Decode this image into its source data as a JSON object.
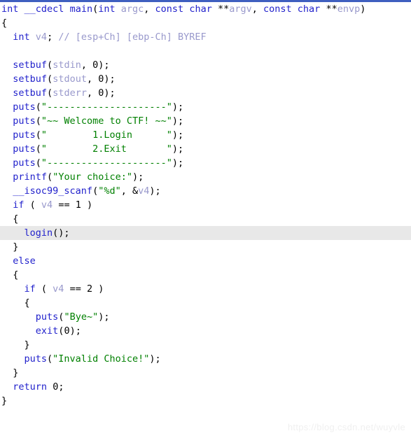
{
  "window": {
    "kind": "decompiler-pseudocode-view",
    "top_rule_color": "#3f5fbf",
    "background_color": "#ffffff",
    "highlight_color": "#e8e8e8"
  },
  "theme": {
    "keyword_color": "#2222cc",
    "function_color": "#2222cc",
    "string_color": "#008000",
    "comment_color": "#9999cc",
    "variable_color": "#9999cc",
    "punctuation_color": "#000000"
  },
  "watermark": {
    "text": "https://blog.csdn.net/wuyvle"
  },
  "code": {
    "highlighted_line_index": 16,
    "lines": [
      {
        "n": 0,
        "tokens": [
          {
            "t": "kw",
            "v": "int"
          },
          {
            "t": "pun",
            "v": " "
          },
          {
            "t": "sym",
            "v": "__cdecl"
          },
          {
            "t": "pun",
            "v": " "
          },
          {
            "t": "sym",
            "v": "main"
          },
          {
            "t": "pun",
            "v": "("
          },
          {
            "t": "kw",
            "v": "int"
          },
          {
            "t": "pun",
            "v": " "
          },
          {
            "t": "var",
            "v": "argc"
          },
          {
            "t": "pun",
            "v": ", "
          },
          {
            "t": "kw",
            "v": "const"
          },
          {
            "t": "pun",
            "v": " "
          },
          {
            "t": "kw",
            "v": "char"
          },
          {
            "t": "pun",
            "v": " **"
          },
          {
            "t": "var",
            "v": "argv"
          },
          {
            "t": "pun",
            "v": ", "
          },
          {
            "t": "kw",
            "v": "const"
          },
          {
            "t": "pun",
            "v": " "
          },
          {
            "t": "kw",
            "v": "char"
          },
          {
            "t": "pun",
            "v": " **"
          },
          {
            "t": "var",
            "v": "envp"
          },
          {
            "t": "pun",
            "v": ")"
          }
        ]
      },
      {
        "n": 1,
        "tokens": [
          {
            "t": "pun",
            "v": "{"
          }
        ]
      },
      {
        "n": 2,
        "tokens": [
          {
            "t": "pun",
            "v": "  "
          },
          {
            "t": "kw",
            "v": "int"
          },
          {
            "t": "pun",
            "v": " "
          },
          {
            "t": "var",
            "v": "v4"
          },
          {
            "t": "pun",
            "v": "; "
          },
          {
            "t": "cmt",
            "v": "// [esp+Ch] [ebp-Ch] BYREF"
          }
        ]
      },
      {
        "n": 3,
        "tokens": [
          {
            "t": "pun",
            "v": ""
          }
        ]
      },
      {
        "n": 4,
        "tokens": [
          {
            "t": "pun",
            "v": "  "
          },
          {
            "t": "fn",
            "v": "setbuf"
          },
          {
            "t": "pun",
            "v": "("
          },
          {
            "t": "var",
            "v": "stdin"
          },
          {
            "t": "pun",
            "v": ", "
          },
          {
            "t": "num",
            "v": "0"
          },
          {
            "t": "pun",
            "v": ");"
          }
        ]
      },
      {
        "n": 5,
        "tokens": [
          {
            "t": "pun",
            "v": "  "
          },
          {
            "t": "fn",
            "v": "setbuf"
          },
          {
            "t": "pun",
            "v": "("
          },
          {
            "t": "var",
            "v": "stdout"
          },
          {
            "t": "pun",
            "v": ", "
          },
          {
            "t": "num",
            "v": "0"
          },
          {
            "t": "pun",
            "v": ");"
          }
        ]
      },
      {
        "n": 6,
        "tokens": [
          {
            "t": "pun",
            "v": "  "
          },
          {
            "t": "fn",
            "v": "setbuf"
          },
          {
            "t": "pun",
            "v": "("
          },
          {
            "t": "var",
            "v": "stderr"
          },
          {
            "t": "pun",
            "v": ", "
          },
          {
            "t": "num",
            "v": "0"
          },
          {
            "t": "pun",
            "v": ");"
          }
        ]
      },
      {
        "n": 7,
        "tokens": [
          {
            "t": "pun",
            "v": "  "
          },
          {
            "t": "fn",
            "v": "puts"
          },
          {
            "t": "pun",
            "v": "("
          },
          {
            "t": "str",
            "v": "\"---------------------\""
          },
          {
            "t": "pun",
            "v": ");"
          }
        ]
      },
      {
        "n": 8,
        "tokens": [
          {
            "t": "pun",
            "v": "  "
          },
          {
            "t": "fn",
            "v": "puts"
          },
          {
            "t": "pun",
            "v": "("
          },
          {
            "t": "str",
            "v": "\"~~ Welcome to CTF! ~~\""
          },
          {
            "t": "pun",
            "v": ");"
          }
        ]
      },
      {
        "n": 9,
        "tokens": [
          {
            "t": "pun",
            "v": "  "
          },
          {
            "t": "fn",
            "v": "puts"
          },
          {
            "t": "pun",
            "v": "("
          },
          {
            "t": "str",
            "v": "\"        1.Login      \""
          },
          {
            "t": "pun",
            "v": ");"
          }
        ]
      },
      {
        "n": 10,
        "tokens": [
          {
            "t": "pun",
            "v": "  "
          },
          {
            "t": "fn",
            "v": "puts"
          },
          {
            "t": "pun",
            "v": "("
          },
          {
            "t": "str",
            "v": "\"        2.Exit       \""
          },
          {
            "t": "pun",
            "v": ");"
          }
        ]
      },
      {
        "n": 11,
        "tokens": [
          {
            "t": "pun",
            "v": "  "
          },
          {
            "t": "fn",
            "v": "puts"
          },
          {
            "t": "pun",
            "v": "("
          },
          {
            "t": "str",
            "v": "\"---------------------\""
          },
          {
            "t": "pun",
            "v": ");"
          }
        ]
      },
      {
        "n": 12,
        "tokens": [
          {
            "t": "pun",
            "v": "  "
          },
          {
            "t": "fn",
            "v": "printf"
          },
          {
            "t": "pun",
            "v": "("
          },
          {
            "t": "str",
            "v": "\"Your choice:\""
          },
          {
            "t": "pun",
            "v": ");"
          }
        ]
      },
      {
        "n": 13,
        "tokens": [
          {
            "t": "pun",
            "v": "  "
          },
          {
            "t": "fn",
            "v": "__isoc99_scanf"
          },
          {
            "t": "pun",
            "v": "("
          },
          {
            "t": "str",
            "v": "\"%d\""
          },
          {
            "t": "pun",
            "v": ", &"
          },
          {
            "t": "var",
            "v": "v4"
          },
          {
            "t": "pun",
            "v": ");"
          }
        ]
      },
      {
        "n": 14,
        "tokens": [
          {
            "t": "pun",
            "v": "  "
          },
          {
            "t": "kw",
            "v": "if"
          },
          {
            "t": "pun",
            "v": " ( "
          },
          {
            "t": "var",
            "v": "v4"
          },
          {
            "t": "pun",
            "v": " == "
          },
          {
            "t": "num",
            "v": "1"
          },
          {
            "t": "pun",
            "v": " )"
          }
        ]
      },
      {
        "n": 15,
        "tokens": [
          {
            "t": "pun",
            "v": "  {"
          }
        ]
      },
      {
        "n": 16,
        "tokens": [
          {
            "t": "pun",
            "v": "    "
          },
          {
            "t": "fn",
            "v": "login"
          },
          {
            "t": "pun",
            "v": "();"
          }
        ]
      },
      {
        "n": 17,
        "tokens": [
          {
            "t": "pun",
            "v": "  }"
          }
        ]
      },
      {
        "n": 18,
        "tokens": [
          {
            "t": "pun",
            "v": "  "
          },
          {
            "t": "kw",
            "v": "else"
          }
        ]
      },
      {
        "n": 19,
        "tokens": [
          {
            "t": "pun",
            "v": "  {"
          }
        ]
      },
      {
        "n": 20,
        "tokens": [
          {
            "t": "pun",
            "v": "    "
          },
          {
            "t": "kw",
            "v": "if"
          },
          {
            "t": "pun",
            "v": " ( "
          },
          {
            "t": "var",
            "v": "v4"
          },
          {
            "t": "pun",
            "v": " == "
          },
          {
            "t": "num",
            "v": "2"
          },
          {
            "t": "pun",
            "v": " )"
          }
        ]
      },
      {
        "n": 21,
        "tokens": [
          {
            "t": "pun",
            "v": "    {"
          }
        ]
      },
      {
        "n": 22,
        "tokens": [
          {
            "t": "pun",
            "v": "      "
          },
          {
            "t": "fn",
            "v": "puts"
          },
          {
            "t": "pun",
            "v": "("
          },
          {
            "t": "str",
            "v": "\"Bye~\""
          },
          {
            "t": "pun",
            "v": ");"
          }
        ]
      },
      {
        "n": 23,
        "tokens": [
          {
            "t": "pun",
            "v": "      "
          },
          {
            "t": "fn",
            "v": "exit"
          },
          {
            "t": "pun",
            "v": "("
          },
          {
            "t": "num",
            "v": "0"
          },
          {
            "t": "pun",
            "v": ");"
          }
        ]
      },
      {
        "n": 24,
        "tokens": [
          {
            "t": "pun",
            "v": "    }"
          }
        ]
      },
      {
        "n": 25,
        "tokens": [
          {
            "t": "pun",
            "v": "    "
          },
          {
            "t": "fn",
            "v": "puts"
          },
          {
            "t": "pun",
            "v": "("
          },
          {
            "t": "str",
            "v": "\"Invalid Choice!\""
          },
          {
            "t": "pun",
            "v": ");"
          }
        ]
      },
      {
        "n": 26,
        "tokens": [
          {
            "t": "pun",
            "v": "  }"
          }
        ]
      },
      {
        "n": 27,
        "tokens": [
          {
            "t": "pun",
            "v": "  "
          },
          {
            "t": "kw",
            "v": "return"
          },
          {
            "t": "pun",
            "v": " "
          },
          {
            "t": "num",
            "v": "0"
          },
          {
            "t": "pun",
            "v": ";"
          }
        ]
      },
      {
        "n": 28,
        "tokens": [
          {
            "t": "pun",
            "v": "}"
          }
        ]
      }
    ]
  }
}
